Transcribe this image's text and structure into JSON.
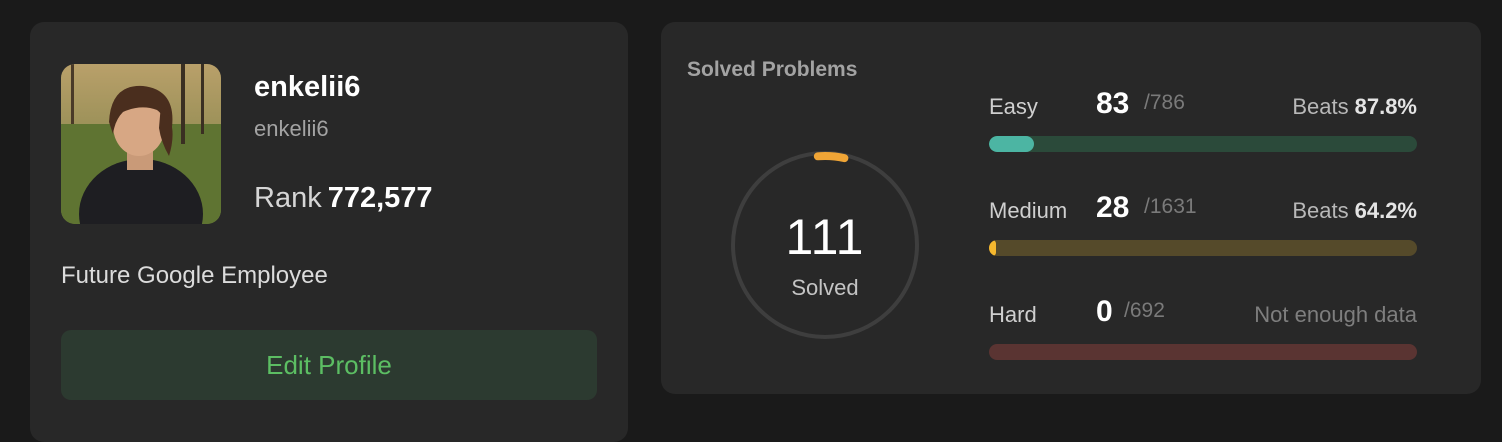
{
  "profile": {
    "username": "enkelii6",
    "handle": "enkelii6",
    "rank_label": "Rank",
    "rank_value": "772,577",
    "bio": "Future Google Employee",
    "edit_button_label": "Edit Profile"
  },
  "stats": {
    "title": "Solved Problems",
    "total_solved": "111",
    "total_label": "Solved",
    "ring_color": "#f0a536",
    "track_color": "#3e3e3e",
    "difficulties": [
      {
        "label": "Easy",
        "solved": "83",
        "total": "/786",
        "beats_label": "Beats",
        "beats_value": "87.8%",
        "fill_fraction": 0.105,
        "fill_color": "#4cb5a3",
        "track_color": "#2b4a3a"
      },
      {
        "label": "Medium",
        "solved": "28",
        "total": "/1631",
        "beats_label": "Beats",
        "beats_value": "64.2%",
        "fill_fraction": 0.017,
        "fill_color": "#f5b82e",
        "track_color": "#554a2a"
      },
      {
        "label": "Hard",
        "solved": "0",
        "total": "/692",
        "status": "Not enough data",
        "fill_fraction": 0,
        "fill_color": "#e04848",
        "track_color": "#5a3432"
      }
    ]
  }
}
